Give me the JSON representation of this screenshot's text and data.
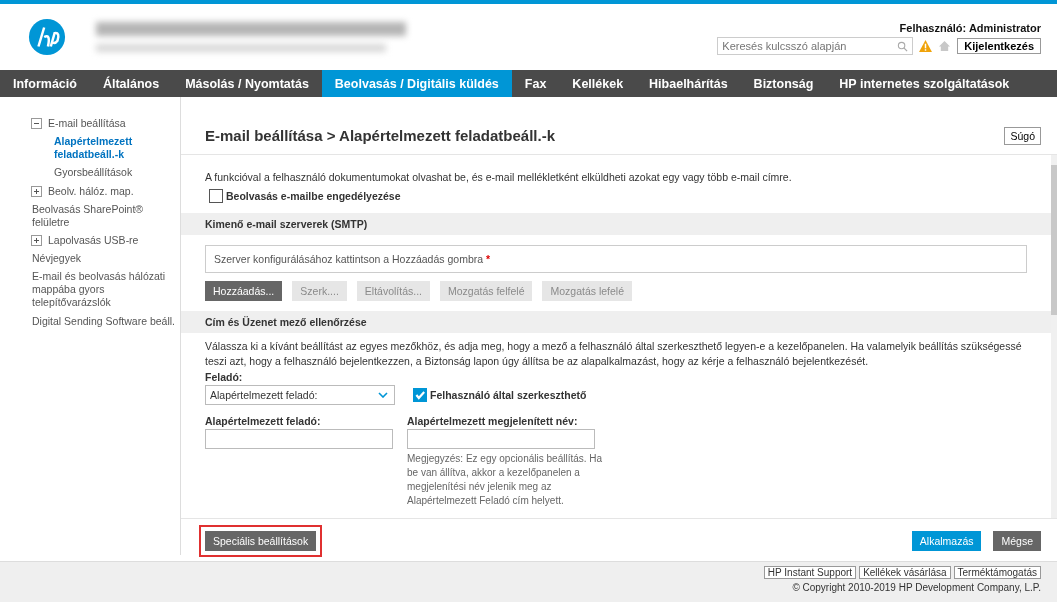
{
  "header": {
    "user_label": "Felhasználó: Administrator",
    "search": {
      "placeholder": "Keresés kulcsszó alapján"
    },
    "logout_button": "Kijelentkezés",
    "warning": true
  },
  "nav": [
    {
      "label": "Információ",
      "selected": false
    },
    {
      "label": "Általános",
      "selected": false
    },
    {
      "label": "Másolás / Nyomtatás",
      "selected": false
    },
    {
      "label": "Beolvasás / Digitális küldés",
      "selected": true
    },
    {
      "label": "Fax",
      "selected": false
    },
    {
      "label": "Kellékek",
      "selected": false
    },
    {
      "label": "Hibaelhárítás",
      "selected": false
    },
    {
      "label": "Biztonság",
      "selected": false
    },
    {
      "label": "HP internetes szolgáltatások",
      "selected": false
    }
  ],
  "sidebar": {
    "items": [
      {
        "label": "E-mail beállítása",
        "kind": "toggle",
        "expanded": true,
        "selected": false,
        "children": [
          {
            "label": "Alapértelmezett feladatbeáll.-k",
            "selected": true
          },
          {
            "label": "Gyorsbeállítások",
            "selected": false
          }
        ]
      },
      {
        "label": "Beolv. hálóz. map.",
        "kind": "toggle",
        "expanded": false,
        "selected": false
      },
      {
        "label": "Beolvasás SharePoint® felületre",
        "kind": "link",
        "selected": false
      },
      {
        "label": "Lapolvasás USB-re",
        "kind": "toggle",
        "expanded": false,
        "selected": false
      },
      {
        "label": "Névjegyek",
        "kind": "link",
        "selected": false
      },
      {
        "label": "E-mail és beolvasás hálózati mappába gyors telepítővarázslók",
        "kind": "link",
        "selected": false
      },
      {
        "label": "Digital Sending Software beáll.",
        "kind": "link",
        "selected": false
      }
    ]
  },
  "page": {
    "title": "E-mail beállítása > Alapértelmezett feladatbeáll.-k",
    "help_button": "Súgó",
    "intro": "A funkcióval a felhasználó dokumentumokat olvashat be, és e-mail mellékletként elküldheti azokat egy vagy több e-mail címre.",
    "enable_checkbox": {
      "label": "Beolvasás e-mailbe engedélyezése",
      "checked": false
    },
    "smtp_section": {
      "heading": "Kimenő e-mail szerverek (SMTP)",
      "placeholder_text": "Szerver konfigurálásához kattintson a Hozzáadás gombra",
      "required_mark": "*",
      "buttons": [
        {
          "label": "Hozzáadás...",
          "disabled": false
        },
        {
          "label": "Szerk....",
          "disabled": true
        },
        {
          "label": "Eltávolítás...",
          "disabled": true
        },
        {
          "label": "Mozgatás felfelé",
          "disabled": true
        },
        {
          "label": "Mozgatás lefelé",
          "disabled": true
        }
      ]
    },
    "address_section": {
      "heading": "Cím és Üzenet mező ellenőrzése",
      "description": "Válassza ki a kívánt beállítást az egyes mezőkhöz, és adja meg, hogy a mező a felhasználó által szerkeszthető legyen-e a kezelőpanelen. Ha valamelyik beállítás szükségessé teszi azt, hogy a felhasználó bejelentkezzen, a Biztonság lapon úgy állítsa be az alapalkalmazást, hogy az kérje a felhasználó bejelentkezését.",
      "from_label": "Feladó:",
      "from_select": "Alapértelmezett feladó:",
      "editable_checkbox": {
        "label": "Felhasználó által szerkeszthető",
        "checked": true
      },
      "default_from_label": "Alapértelmezett feladó:",
      "display_name_label": "Alapértelmezett megjelenített név:",
      "note": "Megjegyzés: Ez egy opcionális beállítás. Ha be van állítva, akkor a kezelőpanelen a megjelenítési név jelenik meg az Alapértelmezett Feladó cím helyett."
    }
  },
  "actions": {
    "advanced_button": {
      "label": "Speciális beállítások",
      "highlighted": true
    },
    "apply_button": "Alkalmazás",
    "cancel_button": "Mégse"
  },
  "footer": {
    "links": [
      "HP Instant Support",
      "Kellékek vásárlása",
      "Terméktámogatás"
    ],
    "copyright": "© Copyright 2010-2019 HP Development Company, L.P."
  }
}
